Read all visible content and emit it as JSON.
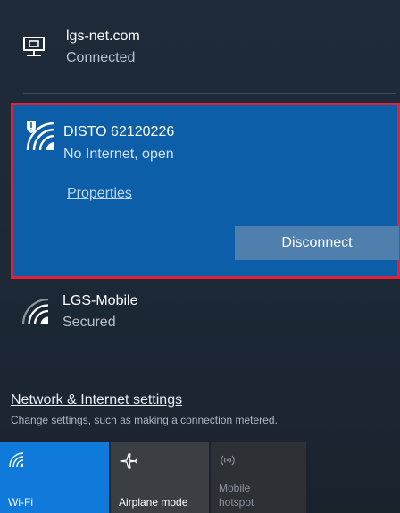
{
  "networks": [
    {
      "name": "lgs-net.com",
      "status": "Connected",
      "icon": "ethernet-icon"
    },
    {
      "name": "DISTO 62120226",
      "status": "No Internet, open",
      "icon": "wifi-warning-icon",
      "properties_label": "Properties",
      "disconnect_label": "Disconnect"
    },
    {
      "name": "LGS-Mobile",
      "status": "Secured",
      "icon": "wifi-icon"
    }
  ],
  "settings": {
    "link_label": "Network & Internet settings",
    "description": "Change settings, such as making a connection metered."
  },
  "quick_actions": [
    {
      "label": "Wi-Fi",
      "icon": "wifi-icon",
      "state": "on"
    },
    {
      "label": "Airplane mode",
      "icon": "airplane-icon",
      "state": "off"
    },
    {
      "label": "Mobile hotspot",
      "label_lines": [
        "Mobile",
        "hotspot"
      ],
      "icon": "hotspot-icon",
      "state": "disabled"
    }
  ],
  "colors": {
    "panel_bg": "#1d2937",
    "selected_bg": "#0d5ea9",
    "highlight_border": "#e0213a",
    "disconnect_bg": "#4f7fad",
    "wifi_tile_on": "#0f7ad9",
    "tile_off": "#3b3f44",
    "tile_disabled": "#2d3136"
  }
}
